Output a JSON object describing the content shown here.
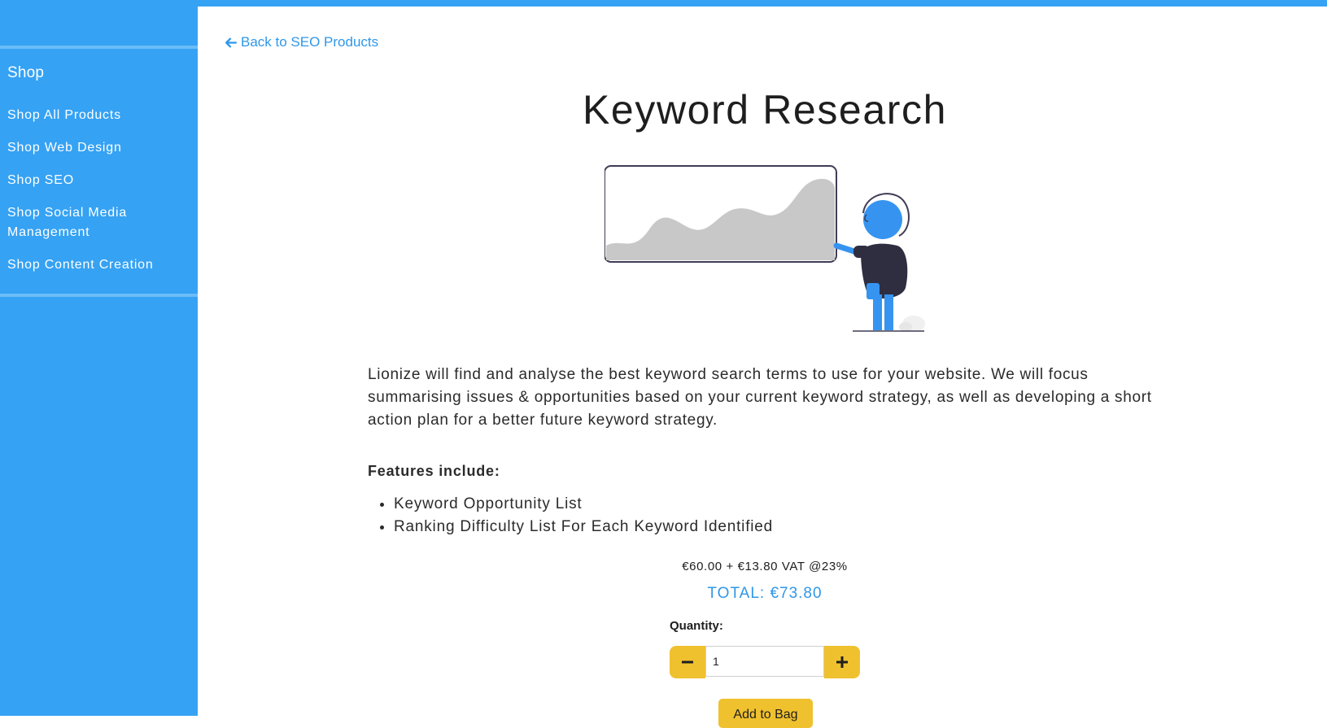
{
  "sidebar": {
    "heading": "Shop",
    "items": [
      {
        "label": "Shop All Products"
      },
      {
        "label": "Shop Web Design"
      },
      {
        "label": "Shop SEO"
      },
      {
        "label": "Shop Social Media Management"
      },
      {
        "label": "Shop Content Creation"
      }
    ]
  },
  "main": {
    "back_link": "Back to SEO Products",
    "title": "Keyword Research",
    "description": "Lionize will find and analyse the best keyword search terms to use for your website. We will focus summarising issues & opportunities based on your current keyword strategy, as well as developing a short action plan for a better future keyword strategy.",
    "features_heading": "Features include:",
    "features": [
      "Keyword Opportunity List",
      "Ranking Difficulty List For Each Keyword Identified"
    ],
    "price_line": "€60.00 + €13.80 VAT @23%",
    "total": "TOTAL: €73.80",
    "quantity_label": "Quantity:",
    "quantity_value": "1",
    "add_to_bag": "Add to Bag"
  },
  "icons": {
    "back": "arrow-left-icon",
    "minus": "minus-icon",
    "plus": "plus-icon",
    "illustration": "person-presenting-chart-illustration"
  },
  "colors": {
    "sidebar_bg": "#35a2f4",
    "link": "#2f97e8",
    "accent_button": "#f0c12e",
    "text": "#1e1e1e"
  }
}
